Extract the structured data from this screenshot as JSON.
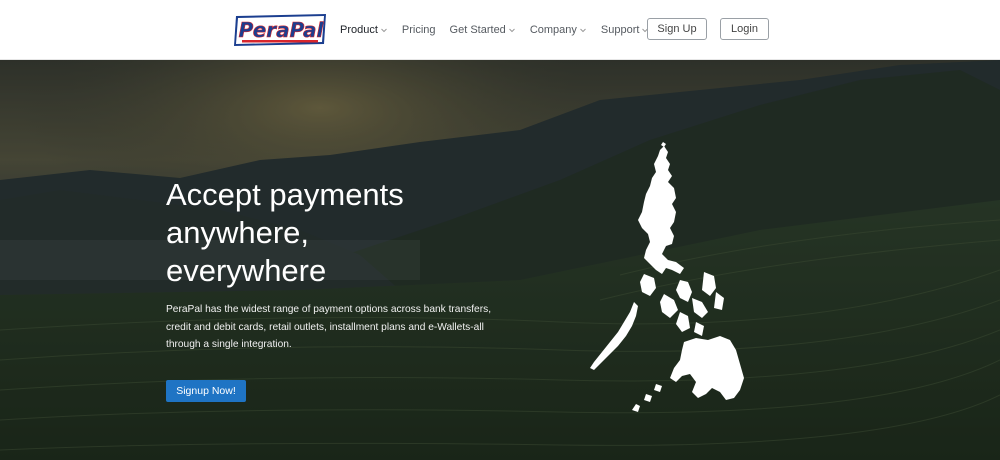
{
  "brand": {
    "logo_text": "PeraPal"
  },
  "nav": {
    "items": [
      {
        "label": "Product",
        "dropdown": true,
        "active": true
      },
      {
        "label": "Pricing",
        "dropdown": false,
        "active": false
      },
      {
        "label": "Get Started",
        "dropdown": true,
        "active": false
      },
      {
        "label": "Company",
        "dropdown": true,
        "active": false
      },
      {
        "label": "Support",
        "dropdown": true,
        "active": false
      }
    ],
    "signup_label": "Sign Up",
    "login_label": "Login"
  },
  "hero": {
    "title_line1": "Accept payments",
    "title_line2": "anywhere,",
    "title_line3": "everywhere",
    "description": "PeraPal has the widest range of payment options across bank transfers, credit and debit cards, retail outlets, installment plans and e-Wallets-all through a single integration.",
    "cta_label": "Signup Now!"
  },
  "colors": {
    "accent": "#1f74c4",
    "logo_blue": "#1b3e8f",
    "logo_red": "#d8262d",
    "header_bg": "#ffffff",
    "hero_overlay": "#1a2328"
  },
  "icons": {
    "dropdown": "chevron-down-icon",
    "map": "philippines-map-icon"
  }
}
